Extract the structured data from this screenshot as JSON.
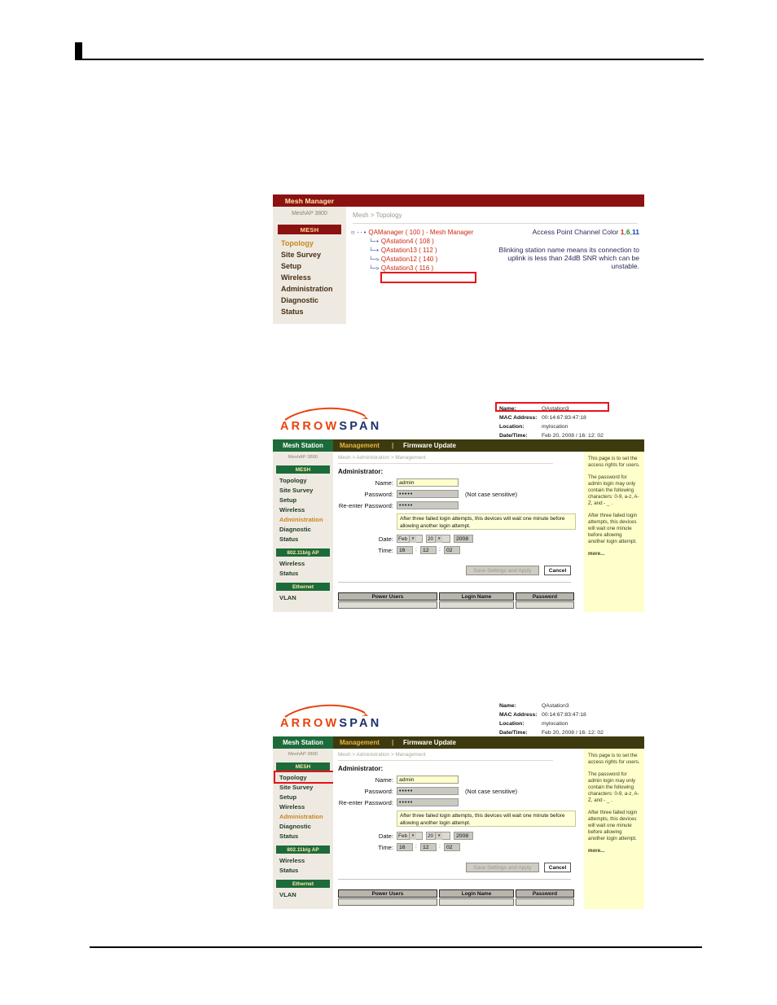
{
  "figure1": {
    "title": "Mesh Manager",
    "model": "MeshAP 3800",
    "group_label": "MESH",
    "nav": [
      "Topology",
      "Site Survey",
      "Setup",
      "Wireless",
      "Administration",
      "Diagnostic",
      "Status"
    ],
    "selected_nav": "Topology",
    "breadcrumb": "Mesh > Topology",
    "tree": {
      "root": "QAManager ( 100 ) - Mesh Manager",
      "children": [
        "QAstation4 ( 108 )",
        "QAstation13 ( 112 )",
        "QAstation12 ( 140 )",
        "QAstation3 ( 116 )"
      ],
      "highlighted": "QAstation3 ( 116 )"
    },
    "channel_legend_prefix": "Access Point Channel Color ",
    "channel_1": "1",
    "channel_sep1": ",",
    "channel_6": "6",
    "channel_sep2": ",",
    "channel_11": "11",
    "blink_note": "Blinking station name means its connection to uplink is less than 24dB SNR which can be unstable.",
    "colors": {
      "titlebar": "#8c1212",
      "nav_selected": "#c9871f",
      "channel1": "#d4241c",
      "channel6": "#1d8a2a",
      "channel11": "#1b3fa8",
      "highlight_box": "#e8131a"
    }
  },
  "arrowspan": {
    "logo_part1": "ARROW",
    "logo_part2": "SPAN",
    "device_info": [
      {
        "key": "Name:",
        "value": "QAstation3"
      },
      {
        "key": "MAC Address:",
        "value": "00:14:67:83:47:18"
      },
      {
        "key": "Location:",
        "value": "mylocation"
      },
      {
        "key": "Date/Time:",
        "value": "Feb 20, 2008 / 16: 12: 02"
      }
    ],
    "tab_left": "Mesh Station",
    "tab_active": "Management",
    "tab_sep": "|",
    "tab_idle": "Firmware Update",
    "model": "MeshAP 3800",
    "breadcrumb": "Mesh > Administration > Management",
    "section_heading": "Administrator:",
    "groups": [
      {
        "label": "MESH",
        "items": [
          "Topology",
          "Site Survey",
          "Setup",
          "Wireless",
          "Administration",
          "Diagnostic",
          "Status"
        ]
      },
      {
        "label": "802.11b/g AP",
        "items": [
          "Wireless",
          "Status"
        ]
      },
      {
        "label": "Ethernet",
        "items": [
          "VLAN"
        ]
      }
    ],
    "selected_nav": "Administration",
    "fields": {
      "name_label": "Name:",
      "name_value": "admin",
      "password_label": "Password:",
      "password_value": "•••••",
      "reenter_label": "Re-enter Password:",
      "reenter_value": "•••••",
      "not_case_sensitive": "(Not case sensitive)",
      "lockout_warning": "After three failed login attempts, this devices will wait one minute before allowing another login attempt.",
      "date_label": "Date:",
      "date_month": "Feb",
      "date_day": "20",
      "date_year": "2008",
      "time_label": "Time:",
      "time_hour": "16",
      "time_min": "12",
      "time_sec": "02",
      "colon": ":"
    },
    "buttons": {
      "save": "Save Settings and Apply",
      "cancel": "Cancel"
    },
    "table": {
      "headers": [
        "Power Users",
        "Login Name",
        "Password"
      ],
      "rows": [
        [
          "",
          "",
          ""
        ]
      ]
    },
    "help": {
      "p1": "This page is to set the access rights for users.",
      "p2": "The password for admin login may only contain the following characters: 0-9, a-z, A-Z, and - _ .",
      "p3": "After three failed login attempts, this devices will wait one minute before allowing another login attempt.",
      "more": "more..."
    }
  },
  "figure2": {
    "highlight_target": "Name:  QAstation3"
  },
  "figure3": {
    "highlight_target": "Topology"
  }
}
